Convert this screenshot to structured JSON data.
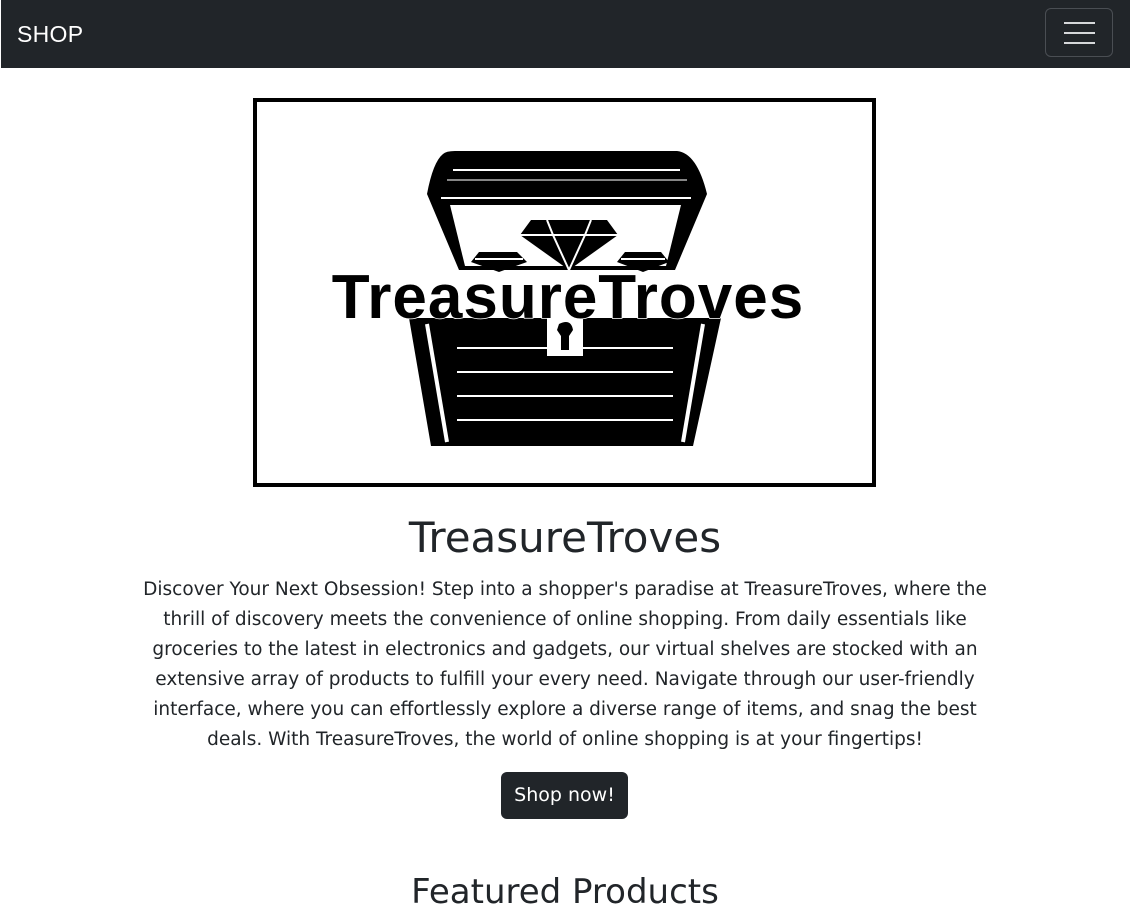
{
  "navbar": {
    "brand": "SHOP",
    "menu_icon": "hamburger-menu-icon"
  },
  "hero": {
    "logo": {
      "icon": "treasure-chest-icon",
      "wordmark": "TreasureTroves"
    },
    "title": "TreasureTroves",
    "description": "Discover Your Next Obsession! Step into a shopper's paradise at TreasureTroves, where the thrill of discovery meets the convenience of online shopping. From daily essentials like groceries to the latest in electronics and gadgets, our virtual shelves are stocked with an extensive array of products to fulfill your every need. Navigate through our user-friendly interface, where you can effortlessly explore a diverse range of items, and snag the best deals. With TreasureTroves, the world of online shopping is at your fingertips!",
    "cta_label": "Shop now!"
  },
  "featured": {
    "heading": "Featured Products"
  },
  "colors": {
    "navbar_bg": "#212529",
    "text": "#212529",
    "button_bg": "#212529",
    "background": "#ffffff"
  }
}
